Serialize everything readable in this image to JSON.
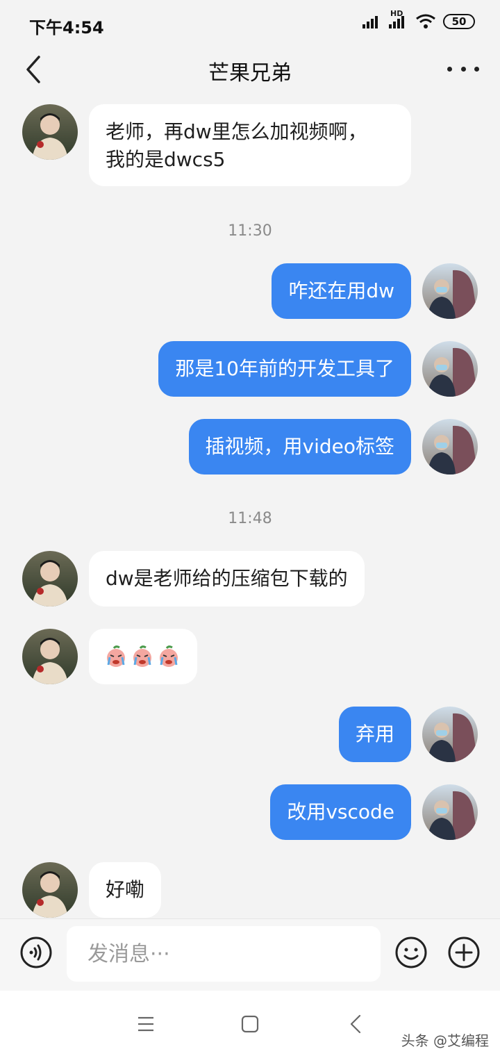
{
  "status_bar": {
    "time": "下午4:54",
    "battery": "50",
    "network": "HD"
  },
  "header": {
    "title": "芒果兄弟",
    "back_icon": "chevron-left-icon",
    "more_icon": "more-horizontal-icon"
  },
  "messages": [
    {
      "side": "left",
      "lines": [
        "老师，再dw里怎么加视频啊，",
        "我的是dwcs5"
      ]
    },
    {
      "type": "time",
      "text": "11:30"
    },
    {
      "side": "right",
      "text": "咋还在用dw"
    },
    {
      "side": "right",
      "text": "那是10年前的开发工具了"
    },
    {
      "side": "right",
      "text": "插视频，用video标签"
    },
    {
      "type": "time",
      "text": "11:48"
    },
    {
      "side": "left",
      "text": "dw是老师给的压缩包下载的"
    },
    {
      "side": "left",
      "emoji": "crying-face-stickers",
      "count": 3
    },
    {
      "side": "right",
      "text": "弃用"
    },
    {
      "side": "right",
      "text": "改用vscode"
    },
    {
      "side": "left",
      "text": "好嘞"
    }
  ],
  "composer": {
    "placeholder": "发消息···"
  },
  "watermark": "头条 @艾编程",
  "colors": {
    "accent": "#3a86f1",
    "background": "#f3f3f3",
    "bubble_left": "#ffffff"
  }
}
